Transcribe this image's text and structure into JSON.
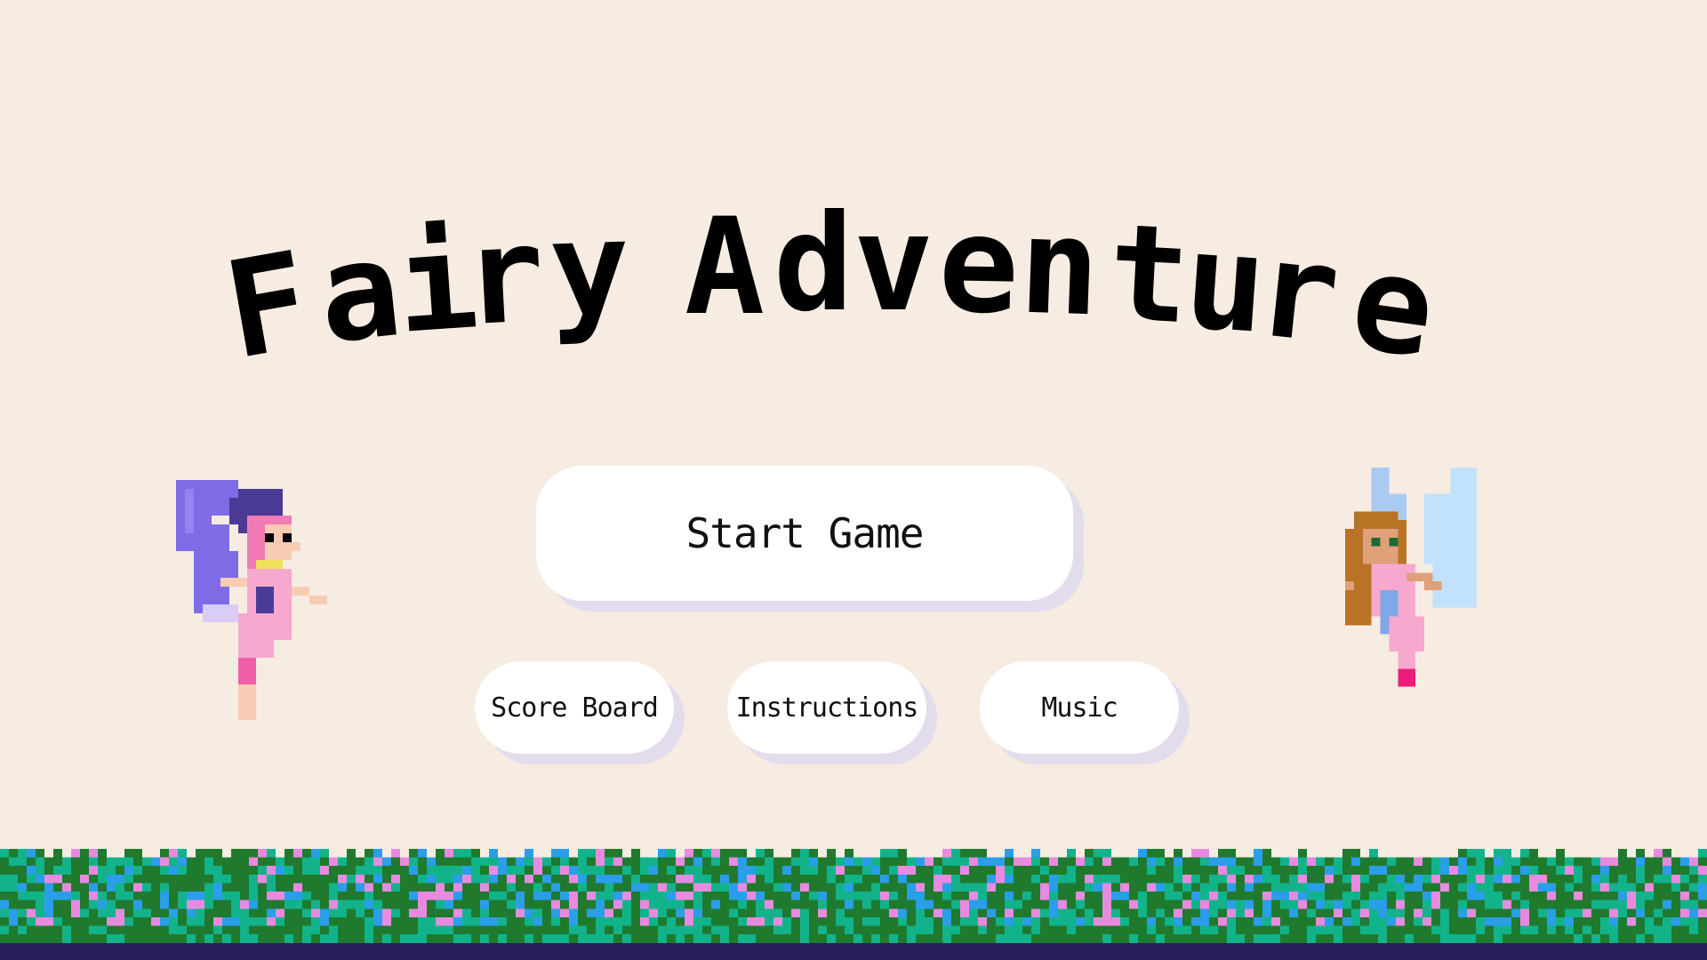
{
  "game": {
    "title": "Fairy Adventure",
    "title_letters": [
      "F",
      "a",
      "i",
      "r",
      "y",
      "A",
      "d",
      "v",
      "e",
      "n",
      "t",
      "u",
      "r",
      "e"
    ]
  },
  "menu": {
    "start_label": "Start Game",
    "scoreboard_label": "Score Board",
    "instructions_label": "Instructions",
    "music_label": "Music"
  },
  "colors": {
    "background": "#f6ece2",
    "button": "#ffffff",
    "button_shadow": "#e3dcec",
    "grass_dark": "#1f7a2e",
    "grass_light": "#12b38a",
    "flower_pink": "#e88be0",
    "flower_blue": "#2a9ee8",
    "soil": "#2a1f5c"
  },
  "sprites": {
    "left_fairy": "pink-haired-fairy-purple-wings",
    "right_fairy": "brown-haired-fairy-blue-wings"
  }
}
